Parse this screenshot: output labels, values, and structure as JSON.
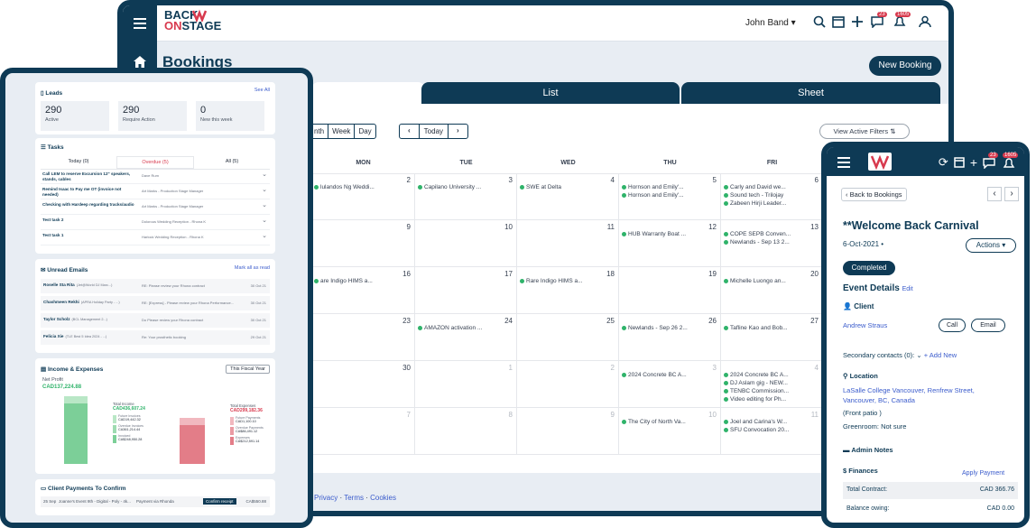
{
  "brand": {
    "line1": "BACK",
    "line2": "ONSTAGE",
    "on": "ON",
    "stage": "STAGE"
  },
  "header": {
    "user": "John Band ▾",
    "messages_badge": "23",
    "alerts_badge": "1605"
  },
  "page": {
    "title": "Bookings",
    "new_booking": "New Booking"
  },
  "tabs": [
    "List",
    "Sheet"
  ],
  "cal": {
    "views": [
      "nth",
      "Week",
      "Day"
    ],
    "today": "Today",
    "prev": "‹",
    "next": "›",
    "filters": "View Active Filters",
    "filters_icon": "⇅",
    "days": [
      "MON",
      "TUE",
      "WED",
      "THU",
      "FRI"
    ],
    "weeks": [
      {
        "nums": [
          "2",
          "3",
          "4",
          "5",
          "6"
        ],
        "grey": [
          false,
          false,
          false,
          false,
          false
        ],
        "events": [
          [
            "lulandos Ng Weddi..."
          ],
          [
            "Capilano University ..."
          ],
          [
            "SWE at Delta"
          ],
          [
            "Hornson and Emily'...",
            "Hornson and Emily'..."
          ],
          [
            "Carly and David we...",
            "Sound tech - Trilojay",
            "Zabeen Hirji Leader..."
          ]
        ]
      },
      {
        "nums": [
          "9",
          "10",
          "11",
          "12",
          "13"
        ],
        "grey": [
          false,
          false,
          false,
          false,
          false
        ],
        "events": [
          [],
          [],
          [],
          [
            "HUB Warranty Boat ..."
          ],
          [
            "COPE SEPB Conven...",
            "Newlands - Sep 13 2..."
          ]
        ]
      },
      {
        "nums": [
          "16",
          "17",
          "18",
          "19",
          "20"
        ],
        "grey": [
          false,
          false,
          false,
          false,
          false
        ],
        "events": [
          [
            "are Indigo HIMS a..."
          ],
          [],
          [
            "Rare Indigo HIMS a..."
          ],
          [],
          [
            "Michelle Luongo an..."
          ]
        ]
      },
      {
        "nums": [
          "23",
          "24",
          "25",
          "26",
          "27"
        ],
        "grey": [
          false,
          false,
          false,
          false,
          false
        ],
        "events": [
          [],
          [
            "AMAZON activation ..."
          ],
          [],
          [
            "Newlands - Sep 26 2..."
          ],
          [
            "Tafline Kao and Bob..."
          ]
        ]
      },
      {
        "nums": [
          "30",
          "1",
          "2",
          "3",
          "4"
        ],
        "grey": [
          false,
          true,
          true,
          true,
          true
        ],
        "events": [
          [],
          [],
          [],
          [
            "2024 Concrete BC A..."
          ],
          [
            "2024 Concrete BC A...",
            "DJ Aslam gig - NEW...",
            "TENBC Commission...",
            "Video editing for Ph..."
          ]
        ]
      },
      {
        "nums": [
          "7",
          "8",
          "9",
          "10",
          "11"
        ],
        "grey": [
          true,
          true,
          true,
          true,
          true
        ],
        "events": [
          [],
          [],
          [],
          [
            "The City of North Va..."
          ],
          [
            "Joel and Carina's W...",
            "SFU Convocation 20..."
          ]
        ]
      }
    ]
  },
  "footer": {
    "privacy": "Privacy",
    "terms": "Terms",
    "cookies": "Cookies",
    "dot": " · "
  },
  "leads": {
    "title": "Leads",
    "see_all": "See All",
    "stats": [
      {
        "n": "290",
        "l": "Active"
      },
      {
        "n": "290",
        "l": "Require Action"
      },
      {
        "n": "0",
        "l": "New this week"
      }
    ]
  },
  "tasks": {
    "title": "Tasks",
    "tabs": [
      "Today (0)",
      "Overdue (5)",
      "All (5)"
    ],
    "rows": [
      {
        "t": "Call LEM to reserve Excursion 12\" speakers, stands, cables",
        "a": "Dave Rum"
      },
      {
        "t": "Remind Isaac to Pay me OT (invoice not needed)",
        "a": "Art Marks - Production Stage Manager"
      },
      {
        "t": "Checking with Hardeep regarding tracks/audio",
        "a": "Art Marks - Production Stage Manager"
      },
      {
        "t": "Test task 2",
        "a": "Dolorous Wedding Reception - Rhona K"
      },
      {
        "t": "Test task 1",
        "a": "Harlock Wedding Reception - Rhona K"
      }
    ]
  },
  "emails": {
    "title": "Unread Emails",
    "mark": "Mark all as read",
    "rows": [
      {
        "n": "Roselle Sta Rita",
        "x": "(Jet@World DJ Marc...)",
        "s": "RE: Please review your Rhona contract",
        "d": "30 Oct 21"
      },
      {
        "n": "Chashmeen Rekhi",
        "x": "(APRA Holiday Party - ...)",
        "s": "RE: [Express] - Please review your Rhona Performance...",
        "d": "30 Oct 21"
      },
      {
        "n": "Taylor Scholz",
        "x": "(BCL Management 2...)",
        "s": "Do Please review your Rhona contract",
        "d": "30 Oct 21"
      },
      {
        "n": "Felicia Xie",
        "x": "(TLE Best 5 Idea 2024 - ...)",
        "s": "Re: Your prosthetic booking",
        "d": "29 Oct 21"
      }
    ]
  },
  "income": {
    "title": "Income & Expenses",
    "select": "This Fiscal Year",
    "net_label": "Net Profit",
    "net": "CAD137,224.88",
    "left": {
      "title": "Total Income",
      "value": "CAD436,607.24",
      "items": [
        [
          "Future Invoices",
          "CAD19,442.32"
        ],
        [
          "Overdue Invoices",
          "CA361,214.44"
        ],
        [
          "Invoiced",
          "CA$248,950.28"
        ]
      ]
    },
    "right": {
      "title": "Total Expenses",
      "value": "CAD299,182.36",
      "items": [
        [
          "Future Payments",
          "CAD1,100.10"
        ],
        [
          "Overdue Payments",
          "CA$86,491.12"
        ],
        [
          "Expenses",
          "CA$212,591.14"
        ]
      ]
    }
  },
  "payments": {
    "title": "Client Payments To Confirm",
    "row": {
      "d": "25 Sep",
      "e": "Joanne's Event 9th - Digital - Poly - 4k...",
      "s": "Payment via Rhonda",
      "b": "Confirm receipt",
      "a": "CA$550.88"
    }
  },
  "detail": {
    "back": "Back to Bookings",
    "title": "**Welcome Back Carnival",
    "date": "6-Oct-2021",
    "dot": " •",
    "actions": "Actions ▾",
    "status": "Completed",
    "ed": "Event Details",
    "edit": "Edit",
    "client_label": "Client",
    "client": "Andrew Straus",
    "call": "Call",
    "email": "Email",
    "secondary": "Secondary contacts (0):",
    "add_new": "Add New",
    "location_label": "Location",
    "location": "LaSalle College Vancouver, Renfrew Street, Vancouver, BC, Canada",
    "front": "(Front patio )",
    "greenroom": "Greenroom: Not sure",
    "admin": "Admin Notes",
    "finances": "Finances",
    "apply": "Apply Payment",
    "contract_label": "Total Contract:",
    "contract": "CAD 366.76",
    "owing_label": "Balance owing:",
    "owing": "CAD 0.00"
  },
  "colors": {
    "navy": "#0e3a55",
    "green": "#2fb36a",
    "red": "#d83a4e"
  }
}
